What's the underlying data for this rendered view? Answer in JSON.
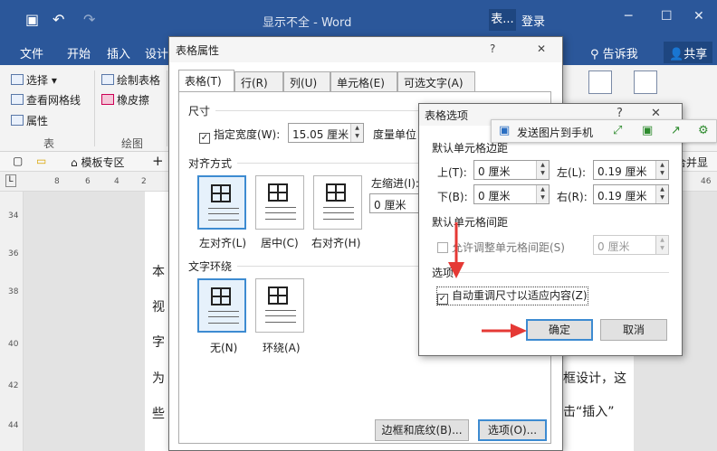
{
  "window": {
    "title": "显示不全 - Word",
    "context_tab": "表...",
    "login": "登录"
  },
  "ribbon_tabs": [
    "文件",
    "开始",
    "插入",
    "设计"
  ],
  "tell_me": "告诉我",
  "share": "共享",
  "ribbon": {
    "select": "选择",
    "gridlines": "查看网格线",
    "properties": "属性",
    "group_table": "表",
    "draw_table": "绘制表格",
    "eraser": "橡皮擦",
    "group_draw": "绘图"
  },
  "tabstrip": {
    "template_zone": "模板专区",
    "plus": "+",
    "merge_partial": "合并显示"
  },
  "ruler_numbers": [
    "8",
    "6",
    "4",
    "2",
    "42",
    "44",
    "46"
  ],
  "vruler_numbers": [
    "34",
    "36",
    "38",
    "40",
    "42",
    "44"
  ],
  "doc_text": {
    "l1": "本",
    "l2": "视",
    "l3": "字",
    "l4": "为",
    "l5": "些",
    "r1": "框设计，这",
    "r2": "击“插入”"
  },
  "table_properties": {
    "title": "表格属性",
    "help": "?",
    "close": "✕",
    "tabs": [
      "表格(T)",
      "行(R)",
      "列(U)",
      "单元格(E)",
      "可选文字(A)"
    ],
    "size_label": "尺寸",
    "preferred_width_label": "指定宽度(W):",
    "preferred_width_value": "15.05 厘米",
    "measure_in_label": "度量单位",
    "alignment_label": "对齐方式",
    "indent_label": "左缩进(I):",
    "indent_value": "0 厘米",
    "align_options": [
      "左对齐(L)",
      "居中(C)",
      "右对齐(H)"
    ],
    "wrapping_label": "文字环绕",
    "wrap_options": [
      "无(N)",
      "环绕(A)"
    ],
    "borders_button": "边框和底纹(B)...",
    "options_button": "选项(O)..."
  },
  "table_options": {
    "title": "表格选项",
    "help": "?",
    "close": "✕",
    "margins_label": "默认单元格边距",
    "top_label": "上(T):",
    "top_value": "0 厘米",
    "left_label": "左(L):",
    "left_value": "0.19 厘米",
    "bottom_label": "下(B):",
    "bottom_value": "0 厘米",
    "right_label": "右(R):",
    "right_value": "0.19 厘米",
    "spacing_label": "默认单元格间距",
    "allow_spacing_label": "允许调整单元格间距(S)",
    "spacing_value": "0 厘米",
    "options_label": "选项",
    "autoresize_label": "自动重调尺寸以适应内容(Z)",
    "autoresize_checked": "✓",
    "ok_button": "确定",
    "cancel_button": "取消"
  },
  "floatbar": {
    "send_to_phone": "发送图片到手机"
  },
  "colors": {
    "word_blue": "#2b579a",
    "accent_focus": "#3d8bd1",
    "arrow_red": "#e53935"
  }
}
